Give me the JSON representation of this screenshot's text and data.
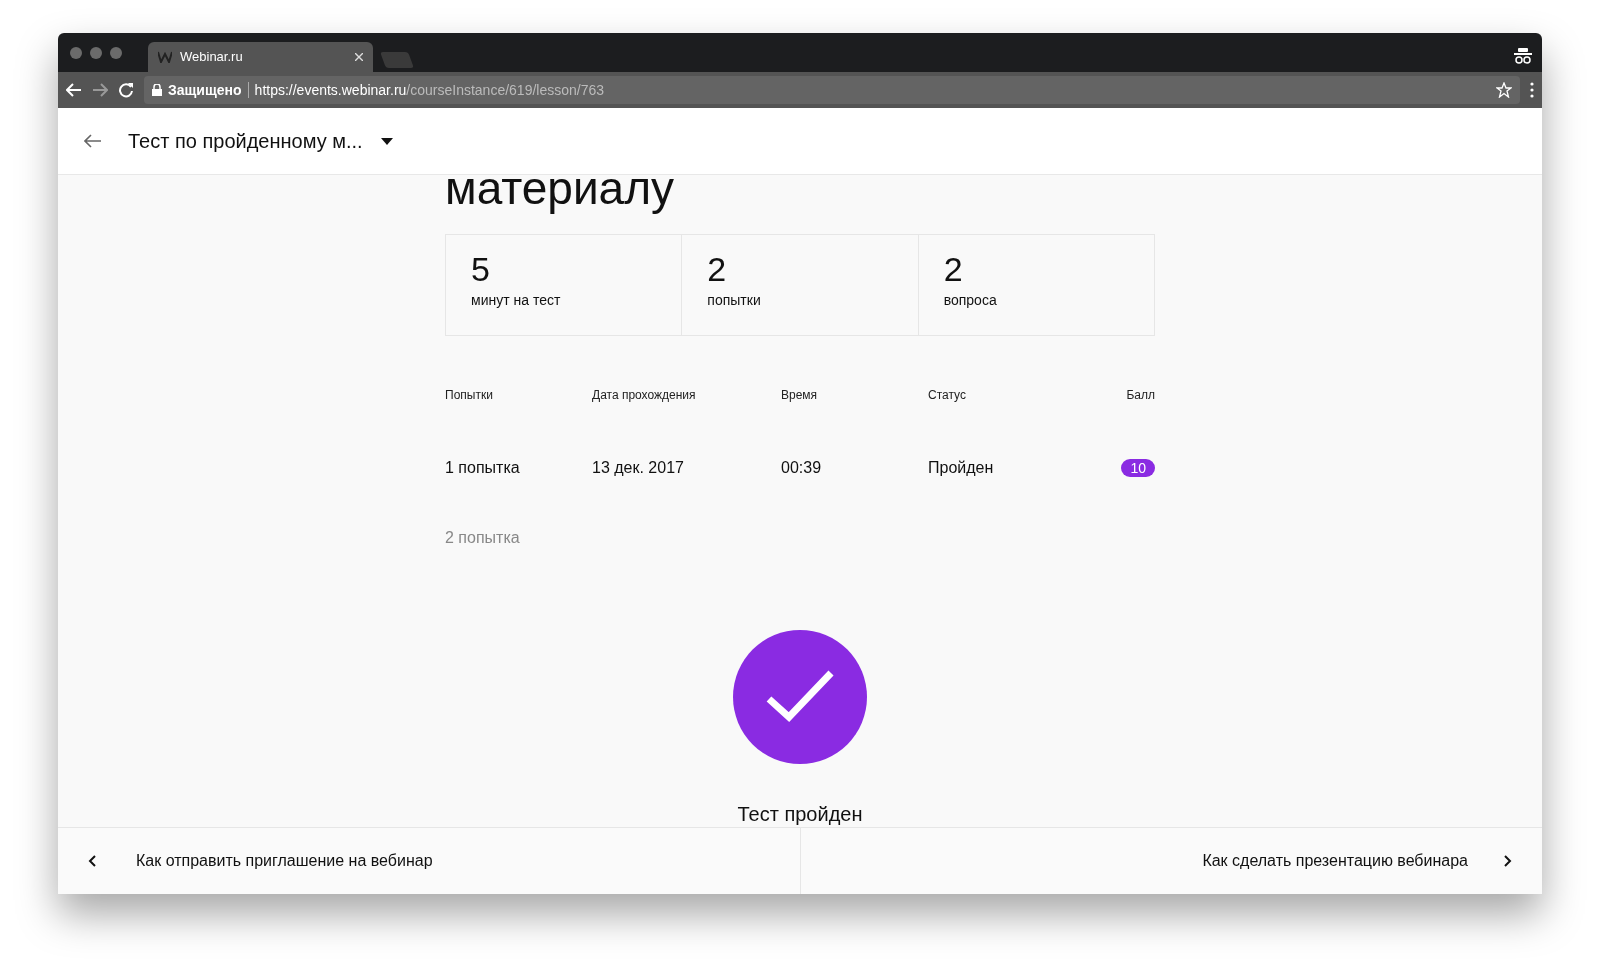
{
  "browser": {
    "tab_title": "Webinar.ru",
    "secure_label": "Защищено",
    "url_host": "https://events.webinar.ru",
    "url_path": "/courseInstance/619/lesson/763"
  },
  "header": {
    "title": "Тест по пройденному м..."
  },
  "page_title": "материалу",
  "stats": [
    {
      "value": "5",
      "label": "минут на тест"
    },
    {
      "value": "2",
      "label": "попытки"
    },
    {
      "value": "2",
      "label": "вопроса"
    }
  ],
  "attempts": {
    "columns": [
      "Попытки",
      "Дата прохождения",
      "Время",
      "Статус",
      "Балл"
    ],
    "rows": [
      {
        "attempt": "1 попытка",
        "date": "13 дек. 2017",
        "time": "00:39",
        "status": "Пройден",
        "score": "10",
        "disabled": false
      },
      {
        "attempt": "2 попытка",
        "disabled": true
      }
    ]
  },
  "result": {
    "passed": true,
    "label": "Тест пройден"
  },
  "footer": {
    "prev": "Как отправить приглашение на вебинар",
    "next": "Как сделать презентацию вебинара"
  }
}
